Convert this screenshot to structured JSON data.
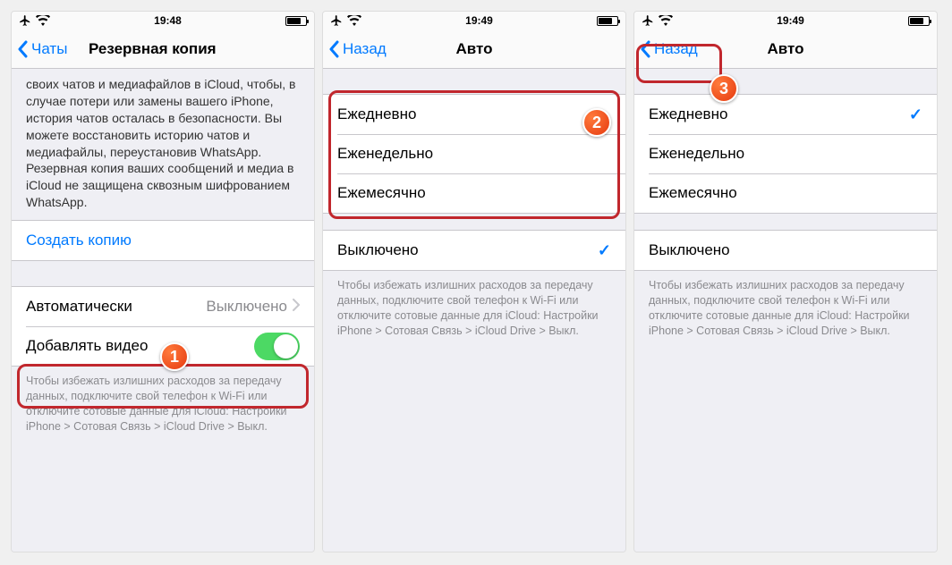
{
  "screens": [
    {
      "status": {
        "time": "19:48"
      },
      "nav": {
        "back": "Чаты",
        "title": "Резервная копия"
      },
      "description": "своих чатов и медиафайлов в iCloud, чтобы, в случае потери или замены вашего iPhone, история чатов осталась в безопасности. Вы можете восстановить историю чатов и медиафайлы, переустановив WhatsApp. Резервная копия ваших сообщений и медиа в iCloud не защищена сквозным шифрованием WhatsApp.",
      "createBackup": "Создать копию",
      "autoLabel": "Автоматически",
      "autoValue": "Выключено",
      "addVideoLabel": "Добавлять видео",
      "footer": "Чтобы избежать излишних расходов за передачу данных, подключите свой телефон к Wi-Fi или отключите сотовые данные для iCloud: Настройки iPhone > Сотовая Связь > iCloud Drive > Выкл."
    },
    {
      "status": {
        "time": "19:49"
      },
      "nav": {
        "back": "Назад",
        "title": "Авто"
      },
      "options": [
        "Ежедневно",
        "Еженедельно",
        "Ежемесячно"
      ],
      "offOption": "Выключено",
      "selectedIndex": 3,
      "footer": "Чтобы избежать излишних расходов за передачу данных, подключите свой телефон к Wi-Fi или отключите сотовые данные для iCloud: Настройки iPhone > Сотовая Связь > iCloud Drive > Выкл."
    },
    {
      "status": {
        "time": "19:49"
      },
      "nav": {
        "back": "Назад",
        "title": "Авто"
      },
      "options": [
        "Ежедневно",
        "Еженедельно",
        "Ежемесячно"
      ],
      "offOption": "Выключено",
      "selectedIndex": 0,
      "footer": "Чтобы избежать излишних расходов за передачу данных, подключите свой телефон к Wi-Fi или отключите сотовые данные для iCloud: Настройки iPhone > Сотовая Связь > iCloud Drive > Выкл."
    }
  ],
  "badges": [
    "1",
    "2",
    "3"
  ]
}
